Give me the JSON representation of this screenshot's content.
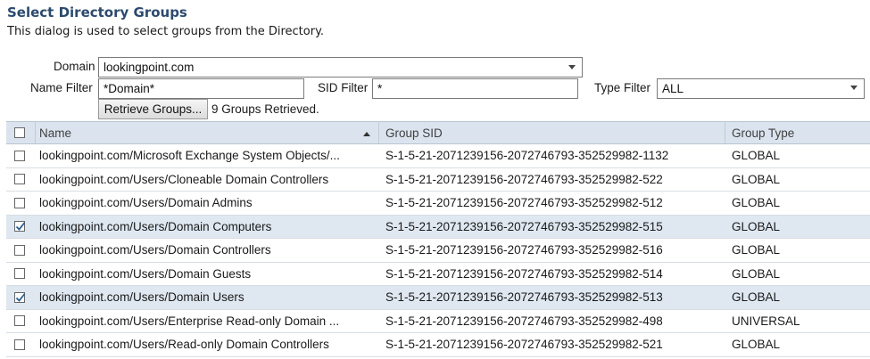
{
  "dialog": {
    "title": "Select Directory Groups",
    "description": "This dialog is used to select groups from the Directory."
  },
  "filters": {
    "domain_label": "Domain",
    "domain_value": "lookingpoint.com",
    "name_filter_label": "Name Filter",
    "name_filter_value": "*Domain*",
    "sid_filter_label": "SID Filter",
    "sid_filter_value": "*",
    "type_filter_label": "Type Filter",
    "type_filter_value": "ALL",
    "retrieve_button": "Retrieve Groups...",
    "status": "9 Groups Retrieved."
  },
  "table": {
    "columns": {
      "name": "Name",
      "sid": "Group SID",
      "type": "Group Type"
    },
    "rows": [
      {
        "name": "lookingpoint.com/Microsoft Exchange System Objects/...",
        "sid": "S-1-5-21-2071239156-2072746793-352529982-1132",
        "type": "GLOBAL",
        "checked": false
      },
      {
        "name": "lookingpoint.com/Users/Cloneable Domain Controllers",
        "sid": "S-1-5-21-2071239156-2072746793-352529982-522",
        "type": "GLOBAL",
        "checked": false
      },
      {
        "name": "lookingpoint.com/Users/Domain Admins",
        "sid": "S-1-5-21-2071239156-2072746793-352529982-512",
        "type": "GLOBAL",
        "checked": false
      },
      {
        "name": "lookingpoint.com/Users/Domain Computers",
        "sid": "S-1-5-21-2071239156-2072746793-352529982-515",
        "type": "GLOBAL",
        "checked": true
      },
      {
        "name": "lookingpoint.com/Users/Domain Controllers",
        "sid": "S-1-5-21-2071239156-2072746793-352529982-516",
        "type": "GLOBAL",
        "checked": false
      },
      {
        "name": "lookingpoint.com/Users/Domain Guests",
        "sid": "S-1-5-21-2071239156-2072746793-352529982-514",
        "type": "GLOBAL",
        "checked": false
      },
      {
        "name": "lookingpoint.com/Users/Domain Users",
        "sid": "S-1-5-21-2071239156-2072746793-352529982-513",
        "type": "GLOBAL",
        "checked": true
      },
      {
        "name": "lookingpoint.com/Users/Enterprise Read-only Domain ...",
        "sid": "S-1-5-21-2071239156-2072746793-352529982-498",
        "type": "UNIVERSAL",
        "checked": false
      },
      {
        "name": "lookingpoint.com/Users/Read-only Domain Controllers",
        "sid": "S-1-5-21-2071239156-2072746793-352529982-521",
        "type": "GLOBAL",
        "checked": false
      }
    ]
  }
}
